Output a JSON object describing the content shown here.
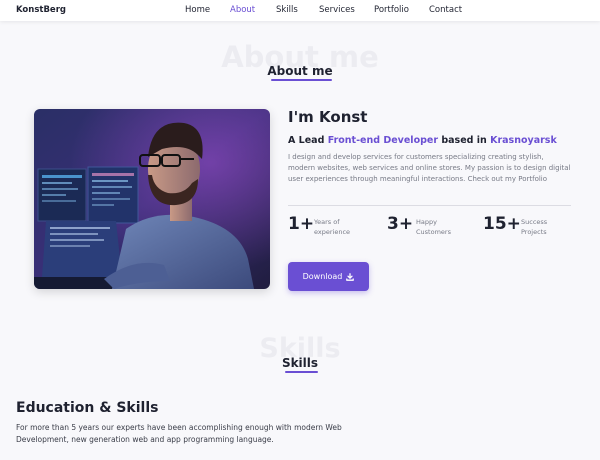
{
  "brand": {
    "logo": "KonstBerg"
  },
  "nav": {
    "items": [
      {
        "label": "Home"
      },
      {
        "label": "About",
        "active": true
      },
      {
        "label": "Skills"
      },
      {
        "label": "Services"
      },
      {
        "label": "Portfolio"
      },
      {
        "label": "Contact"
      }
    ]
  },
  "about": {
    "bg_title": "About me",
    "title": "About me",
    "name": "I'm Konst",
    "role_prefix": "A Lead ",
    "role_title": "Front-end Developer",
    "role_middle": " based in ",
    "role_city": "Krasnoyarsk",
    "description": "I design and develop services for customers specializing creating stylish, modern websites, web services and online stores. My passion is to design digital user experiences through meaningful interactions. Check out my Portfolio",
    "stats": [
      {
        "number": "1+",
        "label_line1": "Years of",
        "label_line2": "experience"
      },
      {
        "number": "3+",
        "label_line1": "Happy",
        "label_line2": "Customers"
      },
      {
        "number": "15+",
        "label_line1": "Success",
        "label_line2": "Projects"
      }
    ],
    "download_label": "Download",
    "download_icon": "download-icon",
    "image_alt": "developer-at-computer-photo"
  },
  "skills": {
    "bg_title": "Skills",
    "title": "Skills",
    "heading": "Education & Skills",
    "description": "For more than 5 years our experts have been accomplishing enough with modern Web Development, new generation web and app programming language."
  },
  "colors": {
    "accent": "#6a4fd3",
    "text": "#1f2230",
    "muted": "#777a86",
    "background": "#f8f8fb"
  }
}
